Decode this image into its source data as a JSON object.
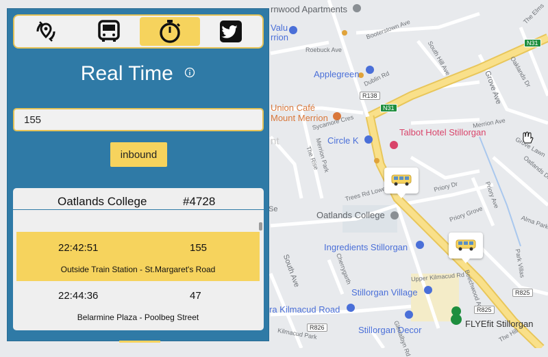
{
  "panel": {
    "title": "Real Time",
    "toolbar": [
      {
        "icon": "nearby-stops-icon",
        "active": false
      },
      {
        "icon": "bus-icon",
        "active": false
      },
      {
        "icon": "stopwatch-icon",
        "active": true
      },
      {
        "icon": "twitter-icon",
        "active": false
      }
    ],
    "route_input_value": "155",
    "direction_label": "inbound",
    "stop": {
      "name": "Oatlands College",
      "number": "#4728"
    },
    "arrivals": [
      {
        "time": "22:42:51",
        "route": "155",
        "destination": "Outside Train Station - St.Margaret's Road"
      },
      {
        "time": "22:44:36",
        "route": "47",
        "destination": "Belarmine Plaza - Poolbeg Street"
      }
    ]
  },
  "map": {
    "pois": [
      {
        "name": "Thornwood Apartments",
        "label": "rnwood Apartments",
        "color": "#5f6368"
      },
      {
        "name": "Valu Merrion",
        "line1": "Valu",
        "line2": "rrion",
        "color": "#4a6fd8"
      },
      {
        "name": "Applegreen",
        "color": "#4a6fd8"
      },
      {
        "name": "Union Café Mount Merrion",
        "line1": "Union Café",
        "line2": "Mount Merrion",
        "color": "#d9773a"
      },
      {
        "name": "Talbot Hotel Stillorgan",
        "color": "#d9446a"
      },
      {
        "name": "Circle K",
        "color": "#4a6fd8"
      },
      {
        "name": "Oatlands College",
        "color": "#5f6368"
      },
      {
        "name": "Ingredients Stillorgan",
        "color": "#4a6fd8"
      },
      {
        "name": "Stillorgan Village",
        "color": "#4a6fd8"
      },
      {
        "name": "Kilmacud Road",
        "label": "ra Kilmacud Road",
        "color": "#4a6fd8"
      },
      {
        "name": "Stillorgan Decor",
        "color": "#4a6fd8"
      },
      {
        "name": "FLYEfit Stillorgan",
        "color": "#333333"
      },
      {
        "name": "nt",
        "color": "#c8c8c8"
      }
    ],
    "streets": [
      "Booterstown Ave",
      "Roebuck Ave",
      "South Hill Ave",
      "Grove Ave",
      "Sycamore Cres",
      "The Rise",
      "Trees Rd Lower",
      "Priory Dr",
      "Priory Ave",
      "Priory Grove",
      "Merrion Ave",
      "Oaklands Dr",
      "South Ave",
      "Cherrygarth",
      "Kilmacud Park",
      "Park Villas",
      "The Elms",
      "Grove Lawn",
      "Alma Park",
      "Beechwood Ave",
      "The Hill",
      "Glenalbyn Rd",
      "Dublin Rd",
      "Merrion Park",
      "Oatlands Dr",
      "Upper Kilmacud Rd",
      "Se"
    ],
    "road_shields": [
      "N31",
      "R138",
      "N31",
      "R825",
      "R825",
      "R826"
    ],
    "colors": {
      "main_road": "#f9e08a",
      "main_road_edge": "#e8c65a",
      "panel": "#2f7aa6",
      "accent": "#f6d35d"
    }
  }
}
